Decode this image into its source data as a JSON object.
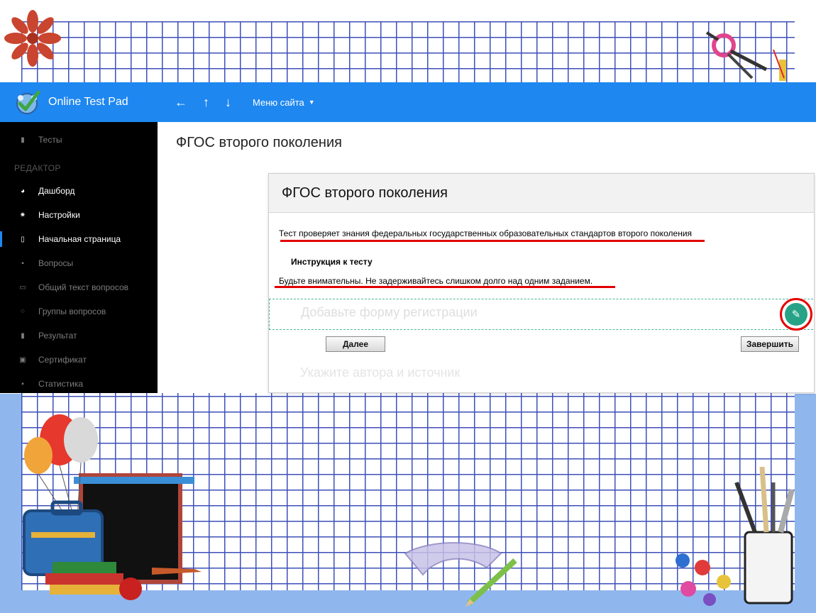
{
  "app": {
    "brand_name": "Online Test Pad",
    "nav": {
      "back": "←",
      "up": "↑",
      "down": "↓",
      "site_menu": "Меню сайта"
    }
  },
  "sidebar": {
    "tests": "Тесты",
    "section_editor": "РЕДАКТОР",
    "items": [
      {
        "label": "Дашборд",
        "icon": "dashboard-icon",
        "state": "normal"
      },
      {
        "label": "Настройки",
        "icon": "gear-icon",
        "state": "normal"
      },
      {
        "label": "Начальная страница",
        "icon": "document-icon",
        "state": "active"
      },
      {
        "label": "Вопросы",
        "icon": "question-icon",
        "state": "dim"
      },
      {
        "label": "Общий текст вопросов",
        "icon": "text-icon",
        "state": "dim"
      },
      {
        "label": "Группы вопросов",
        "icon": "groups-icon",
        "state": "dim"
      },
      {
        "label": "Результат",
        "icon": "chart-icon",
        "state": "dim"
      },
      {
        "label": "Сертификат",
        "icon": "certificate-icon",
        "state": "dim"
      },
      {
        "label": "Статистика",
        "icon": "stats-icon",
        "state": "dim"
      }
    ]
  },
  "main": {
    "page_title": "ФГОС второго поколения",
    "card": {
      "title": "ФГОС второго поколения",
      "description": "Тест проверяет знания федеральных государственных образовательных стандартов второго поколения",
      "instruction_title": "Инструкция к тесту",
      "instruction": "Будьте внимательны. Не задерживайтесь слишком долго над одним заданием.",
      "registration_placeholder": "Добавьте форму регистрации",
      "next_button": "Далее",
      "finish_button": "Завершить",
      "author_placeholder": "Укажите автора и источник"
    }
  },
  "colors": {
    "topbar": "#1e87f0",
    "sidebar": "#000000",
    "highlight": "#e10000",
    "edit_button": "#26a387"
  }
}
